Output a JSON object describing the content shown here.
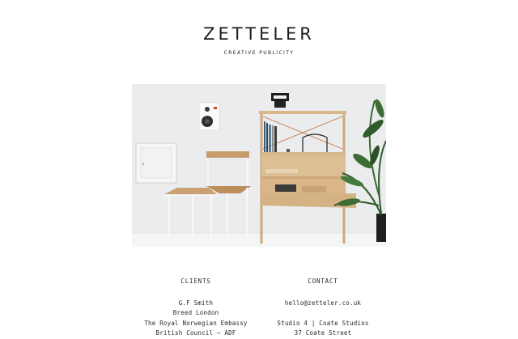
{
  "header": {
    "logo": "ZETTELER",
    "tagline": "CREATIVE PUBLICITY"
  },
  "hero": {
    "image_description": "chair, desk and shelving unit with speaker, clock and plant"
  },
  "clients": {
    "heading": "CLIENTS",
    "items": [
      "G.F Smith",
      "Breed London",
      "The Royal Norwegian Embassy",
      "British Council – ADF"
    ]
  },
  "contact": {
    "heading": "CONTACT",
    "lines": [
      "hello@zetteler.co.uk",
      "",
      "Studio 4 | Coate Studios",
      "37 Coate Street"
    ]
  },
  "colors": {
    "background": "#ffffff",
    "text": "#222222",
    "wall": "#e9eaea",
    "wood": "#cfa877"
  }
}
